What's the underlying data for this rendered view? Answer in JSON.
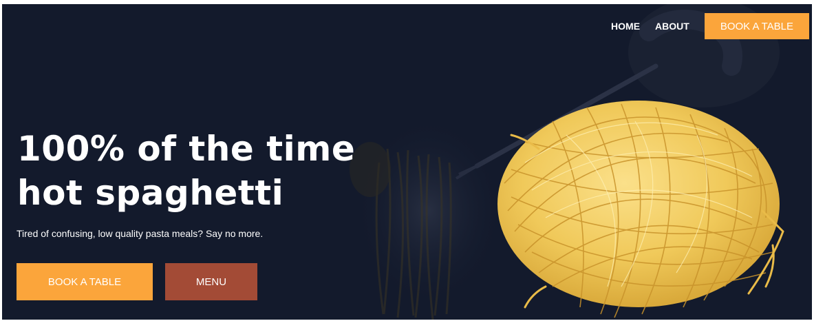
{
  "nav": {
    "home_label": "HOME",
    "about_label": "ABOUT",
    "book_label": "BOOK A TABLE"
  },
  "hero": {
    "headline_line1": "100% of the time",
    "headline_line2": "hot spaghetti",
    "subtitle": "Tired of confusing, low quality pasta meals? Say no more.",
    "primary_button": "BOOK A TABLE",
    "secondary_button": "MENU"
  },
  "colors": {
    "background": "#131a2c",
    "accent_orange": "#fba53b",
    "menu_brown": "#a34b36",
    "pasta_yellow": "#f2cf5c"
  }
}
